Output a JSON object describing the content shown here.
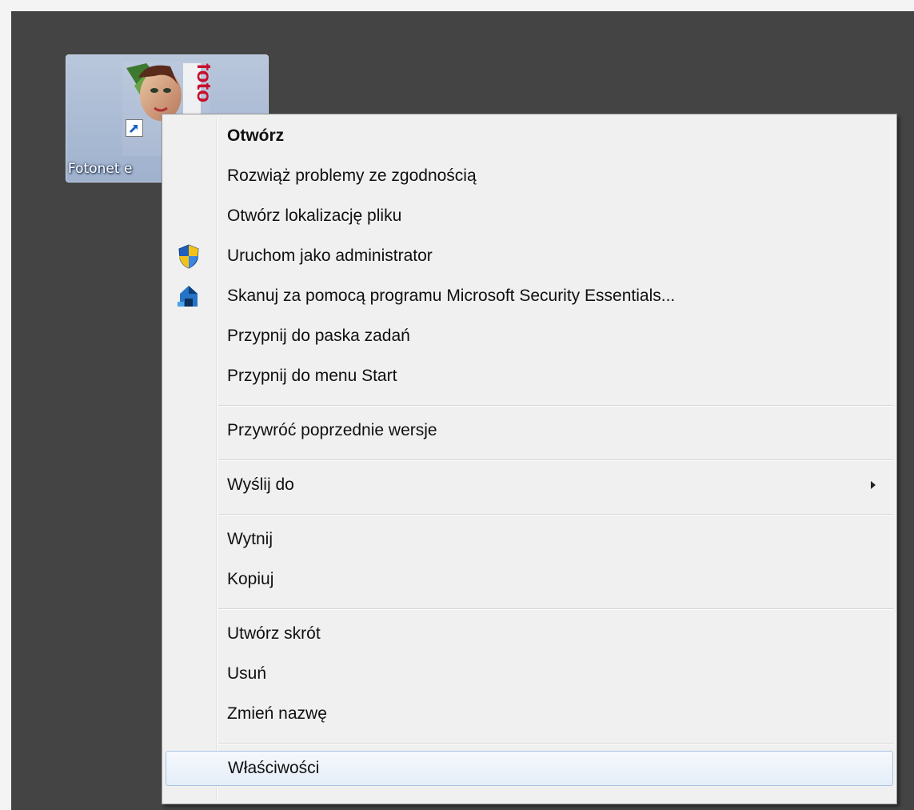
{
  "desktop": {
    "shortcut": {
      "label": "Fotonet e",
      "thumb_text": "foto",
      "icon": "fotonet-app-icon",
      "overlay_icon": "shortcut-arrow-icon"
    }
  },
  "context_menu": {
    "groups": [
      {
        "items": [
          {
            "label": "Otwórz",
            "bold": true
          },
          {
            "label": "Rozwiąż problemy ze zgodnością"
          },
          {
            "label": "Otwórz lokalizację pliku"
          },
          {
            "label": "Uruchom jako administrator",
            "icon": "uac-shield-icon"
          },
          {
            "label": "Skanuj za pomocą programu Microsoft Security Essentials...",
            "icon": "security-essentials-icon"
          },
          {
            "label": "Przypnij do paska zadań"
          },
          {
            "label": "Przypnij do menu Start"
          }
        ]
      },
      {
        "items": [
          {
            "label": "Przywróć poprzednie wersje"
          }
        ]
      },
      {
        "items": [
          {
            "label": "Wyślij do",
            "submenu": true
          }
        ]
      },
      {
        "items": [
          {
            "label": "Wytnij"
          },
          {
            "label": "Kopiuj"
          }
        ]
      },
      {
        "items": [
          {
            "label": "Utwórz skrót"
          },
          {
            "label": "Usuń"
          },
          {
            "label": "Zmień nazwę"
          }
        ]
      },
      {
        "items": [
          {
            "label": "Właściwości",
            "highlighted": true
          }
        ]
      }
    ]
  }
}
